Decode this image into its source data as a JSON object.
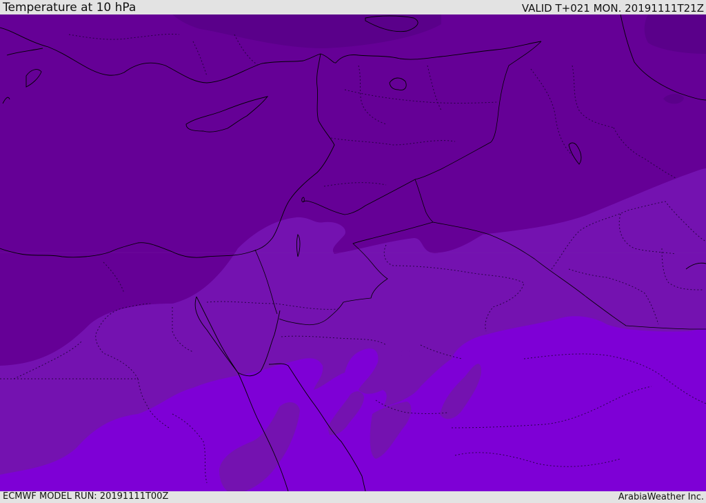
{
  "header": {
    "title": "Temperature at 10 hPa",
    "valid_time": "VALID T+021 MON. 20191111T21Z"
  },
  "footer": {
    "model_run": "ECMWF MODEL RUN: 20191111T00Z",
    "credit": "ArabiaWeather Inc."
  },
  "map": {
    "colors": {
      "coldest": "#5a008a",
      "colder": "#650096",
      "cold": "#7412b0",
      "mild": "#7e00d6",
      "coastline": "#000000",
      "border": "#000000",
      "admin_border": "#1a0033"
    }
  }
}
